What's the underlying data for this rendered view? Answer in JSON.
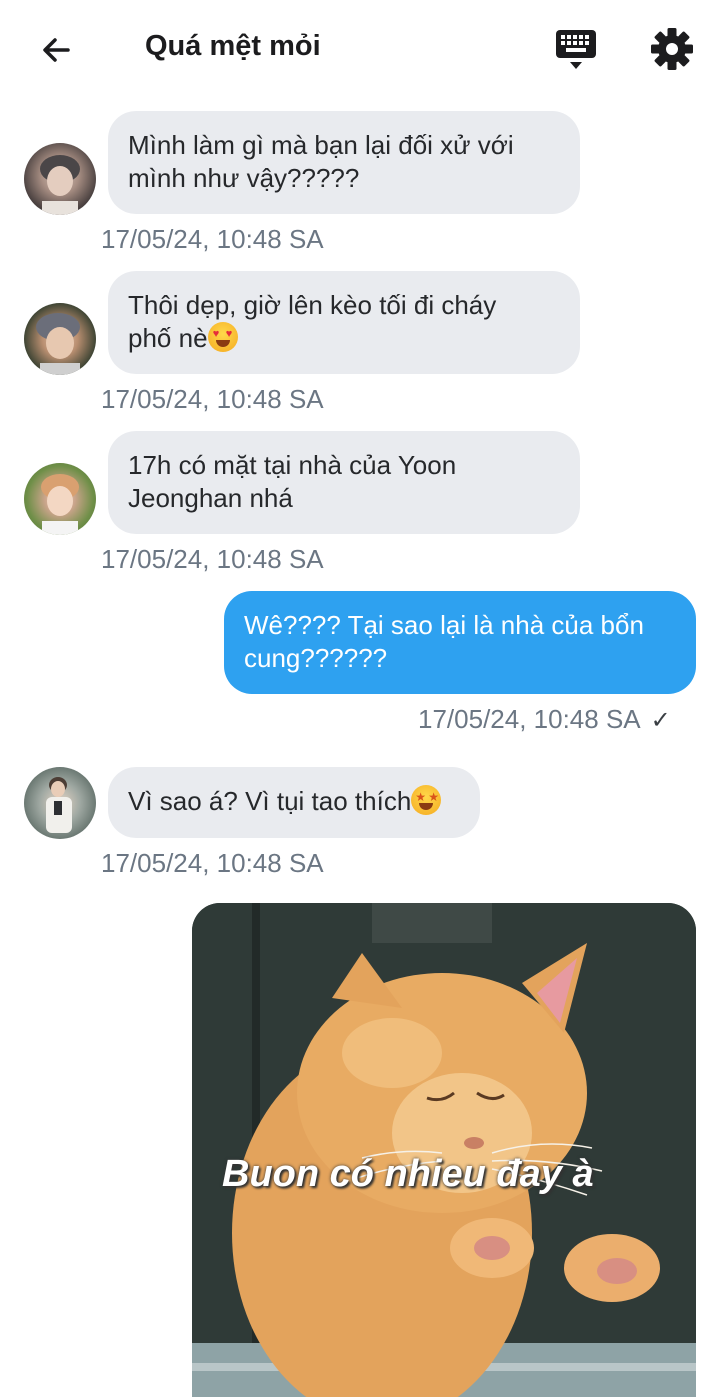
{
  "header": {
    "title": "Quá mệt mỏi",
    "back_icon": "arrow-left-icon",
    "keyboard_icon": "keyboard-hide-icon",
    "settings_icon": "gear-icon"
  },
  "messages": [
    {
      "direction": "incoming",
      "text_line1": "Mình làm gì mà bạn lại đối xử với",
      "text_line2": "mình như vậy?????",
      "time": "17/05/24, 10:48 SA"
    },
    {
      "direction": "incoming",
      "text_line1": "Thôi dẹp, giờ lên kèo tối đi cháy",
      "text_line2": "phố nè",
      "emoji": "heart-eyes-emoji",
      "time": "17/05/24, 10:48 SA"
    },
    {
      "direction": "incoming",
      "text_line1": "17h có mặt tại nhà của Yoon",
      "text_line2": "Jeonghan nhá",
      "time": "17/05/24, 10:48 SA"
    },
    {
      "direction": "outgoing",
      "text_line1": "Wê???? Tại sao lại là nhà của bổn",
      "text_line2": "cung??????",
      "time": "17/05/24, 10:48 SA",
      "status": "✓"
    },
    {
      "direction": "incoming",
      "text_line1": "Vì sao á? Vì tụi tao thích",
      "emoji": "star-struck-emoji",
      "time": "17/05/24, 10:48 SA"
    },
    {
      "direction": "outgoing",
      "type": "image",
      "caption": "Buon có nhieu đay à"
    }
  ],
  "colors": {
    "incoming_bubble": "#e9ebef",
    "outgoing_bubble": "#2ea1f0",
    "timestamp": "#6b7683"
  }
}
